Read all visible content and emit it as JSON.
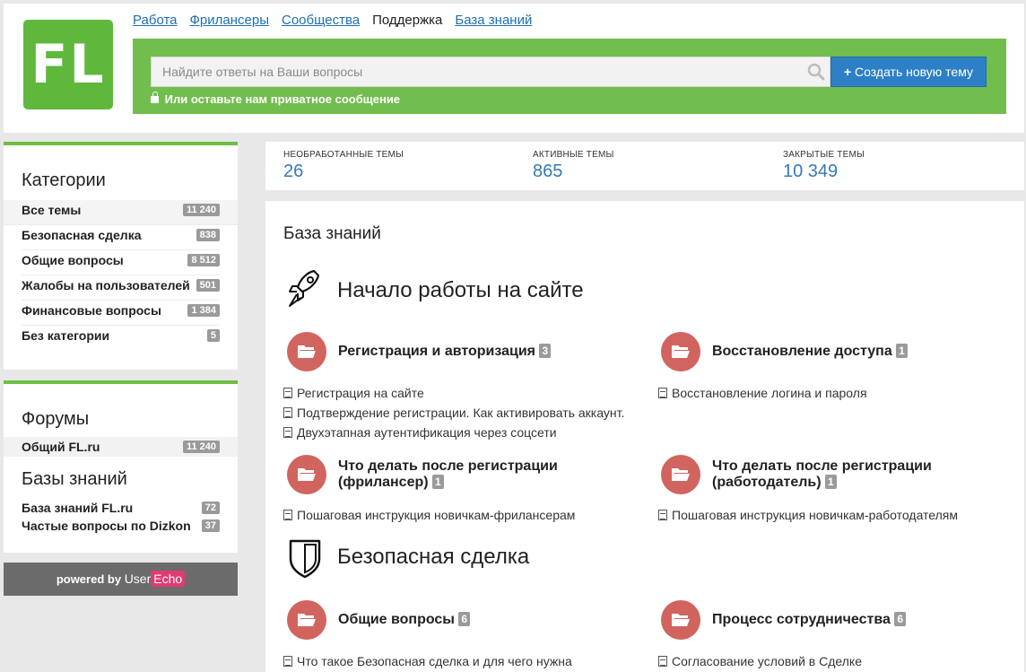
{
  "brand": {
    "logo_text": "FL",
    "colors": {
      "green": "#6ebd45",
      "blue": "#2d80c6",
      "folder": "#d1645f"
    }
  },
  "nav": {
    "items": [
      {
        "label": "Работа",
        "active": false
      },
      {
        "label": "Фрилансеры",
        "active": false
      },
      {
        "label": "Сообщества",
        "active": false
      },
      {
        "label": "Поддержка",
        "active": true
      },
      {
        "label": "База знаний",
        "active": false
      }
    ]
  },
  "search": {
    "placeholder": "Найдите ответы на Ваши вопросы",
    "create_label": "Создать новую тему",
    "private_label": "Или оставьте нам приватное сообщение"
  },
  "sidebar": {
    "categories_title": "Категории",
    "categories": [
      {
        "label": "Все темы",
        "count": "11 240"
      },
      {
        "label": "Безопасная сделка",
        "count": "838"
      },
      {
        "label": "Общие вопросы",
        "count": "8 512"
      },
      {
        "label": "Жалобы на пользователей",
        "count": "501"
      },
      {
        "label": "Финансовые вопросы",
        "count": "1 384"
      },
      {
        "label": "Без категории",
        "count": "5"
      }
    ],
    "forums_title": "Форумы",
    "forums": [
      {
        "label": "Общий FL.ru",
        "count": "11 240"
      }
    ],
    "kb_title": "Базы знаний",
    "kbs": [
      {
        "label": "База знаний FL.ru",
        "count": "72"
      },
      {
        "label": "Частые вопросы по Dizkon",
        "count": "37"
      }
    ],
    "powered_by": "powered by",
    "powered_user": "User",
    "powered_echo": "Echo"
  },
  "stats": [
    {
      "label": "Необработанные темы",
      "value": "26"
    },
    {
      "label": "Активные темы",
      "value": "865"
    },
    {
      "label": "Закрытые темы",
      "value": "10 349"
    }
  ],
  "main": {
    "title": "База знаний",
    "sections": [
      {
        "title": "Начало работы на сайте",
        "icon": "rocket-icon",
        "topics": [
          {
            "name": "Регистрация и авторизация",
            "count": "3",
            "articles": [
              "Регистрация на сайте",
              "Подтверждение регистрации. Как активировать аккаунт.",
              "Двухэтапная аутентификация через соцсети"
            ]
          },
          {
            "name": "Восстановление доступа",
            "count": "1",
            "articles": [
              "Восстановление логина и пароля"
            ]
          },
          {
            "name": "Что делать после регистрации (фрилансер)",
            "count": "1",
            "articles": [
              "Пошаговая инструкция новичкам-фрилансерам"
            ]
          },
          {
            "name": "Что делать после регистрации (работодатель)",
            "count": "1",
            "articles": [
              "Пошаговая инструкция новичкам-работодателям"
            ]
          }
        ]
      },
      {
        "title": "Безопасная сделка",
        "icon": "shield-icon",
        "topics": [
          {
            "name": "Общие вопросы",
            "count": "6",
            "articles": [
              "Что такое Безопасная сделка и для чего нужна"
            ]
          },
          {
            "name": "Процесс сотрудничества",
            "count": "6",
            "articles": [
              "Согласование условий в Сделке"
            ]
          }
        ]
      }
    ]
  }
}
